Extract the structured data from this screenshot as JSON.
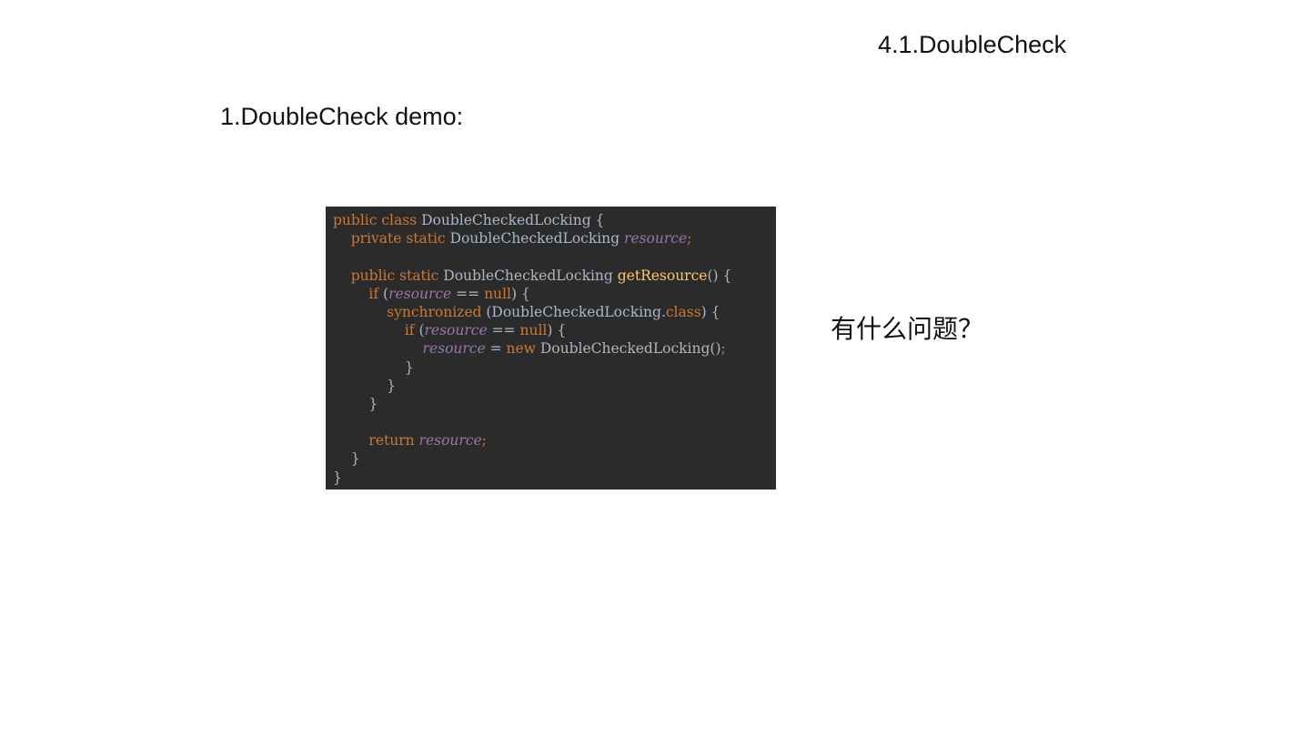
{
  "slide": {
    "title": "4.1.DoubleCheck",
    "section_heading": "1.DoubleCheck demo:",
    "question": "有什么问题？"
  },
  "code": {
    "language": "java",
    "colors": {
      "background": "#2b2b2b",
      "keyword": "#cc7832",
      "identifier": "#a9b7c6",
      "field": "#9876aa",
      "method": "#ffc66d"
    },
    "lines": [
      {
        "text": "public class DoubleCheckedLocking {",
        "tokens": [
          {
            "t": "public class ",
            "c": "kw"
          },
          {
            "t": "DoubleCheckedLocking {",
            "c": "ty"
          }
        ]
      },
      {
        "text": "    private static DoubleCheckedLocking resource;",
        "tokens": [
          {
            "t": "    private static ",
            "c": "kw"
          },
          {
            "t": "DoubleCheckedLocking ",
            "c": "ty"
          },
          {
            "t": "resource",
            "c": "fld"
          },
          {
            "t": ";",
            "c": "kw"
          }
        ]
      },
      {
        "text": "",
        "tokens": []
      },
      {
        "text": "    public static DoubleCheckedLocking getResource() {",
        "tokens": [
          {
            "t": "    public static ",
            "c": "kw"
          },
          {
            "t": "DoubleCheckedLocking ",
            "c": "ty"
          },
          {
            "t": "getResource",
            "c": "fn"
          },
          {
            "t": "() {",
            "c": "pn"
          }
        ]
      },
      {
        "text": "        if (resource == null) {",
        "tokens": [
          {
            "t": "        if ",
            "c": "kw"
          },
          {
            "t": "(",
            "c": "pn"
          },
          {
            "t": "resource",
            "c": "fld"
          },
          {
            "t": " == ",
            "c": "pn"
          },
          {
            "t": "null",
            "c": "kw"
          },
          {
            "t": ") {",
            "c": "pn"
          }
        ]
      },
      {
        "text": "            synchronized (DoubleCheckedLocking.class) {",
        "tokens": [
          {
            "t": "            synchronized ",
            "c": "kw"
          },
          {
            "t": "(DoubleCheckedLocking.",
            "c": "ty"
          },
          {
            "t": "class",
            "c": "kw"
          },
          {
            "t": ") {",
            "c": "pn"
          }
        ]
      },
      {
        "text": "                if (resource == null) {",
        "tokens": [
          {
            "t": "                if ",
            "c": "kw"
          },
          {
            "t": "(",
            "c": "pn"
          },
          {
            "t": "resource",
            "c": "fld"
          },
          {
            "t": " == ",
            "c": "pn"
          },
          {
            "t": "null",
            "c": "kw"
          },
          {
            "t": ") {",
            "c": "pn"
          }
        ]
      },
      {
        "text": "                    resource = new DoubleCheckedLocking();",
        "tokens": [
          {
            "t": "                    ",
            "c": "pn"
          },
          {
            "t": "resource",
            "c": "fld"
          },
          {
            "t": " = ",
            "c": "pn"
          },
          {
            "t": "new ",
            "c": "kw"
          },
          {
            "t": "DoubleCheckedLocking()",
            "c": "ty"
          },
          {
            "t": ";",
            "c": "kw"
          }
        ]
      },
      {
        "text": "                }",
        "tokens": [
          {
            "t": "                }",
            "c": "pn"
          }
        ]
      },
      {
        "text": "            }",
        "tokens": [
          {
            "t": "            }",
            "c": "pn"
          }
        ]
      },
      {
        "text": "        }",
        "tokens": [
          {
            "t": "        }",
            "c": "pn"
          }
        ]
      },
      {
        "text": "",
        "tokens": []
      },
      {
        "text": "        return resource;",
        "tokens": [
          {
            "t": "        return ",
            "c": "kw"
          },
          {
            "t": "resource",
            "c": "fld"
          },
          {
            "t": ";",
            "c": "kw"
          }
        ]
      },
      {
        "text": "    }",
        "tokens": [
          {
            "t": "    }",
            "c": "pn"
          }
        ]
      },
      {
        "text": "}",
        "tokens": [
          {
            "t": "}",
            "c": "pn"
          }
        ]
      }
    ]
  }
}
